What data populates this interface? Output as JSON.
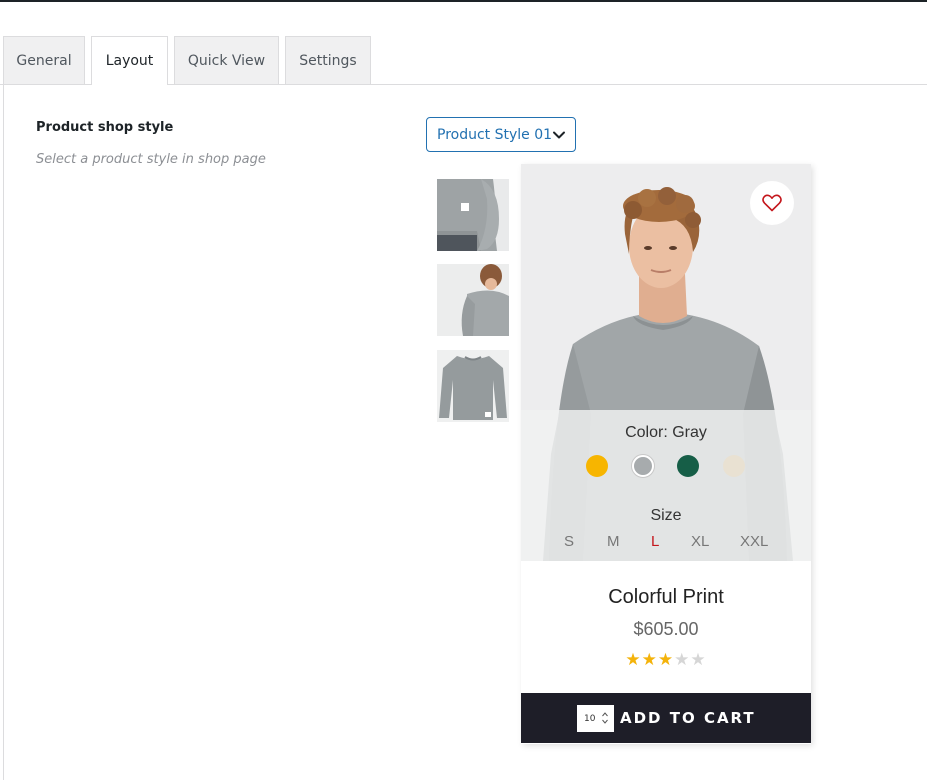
{
  "tabs": [
    {
      "label": "General"
    },
    {
      "label": "Layout"
    },
    {
      "label": "Quick View"
    },
    {
      "label": "Settings"
    }
  ],
  "setting": {
    "label": "Product shop style",
    "description": "Select a product style in shop page",
    "selected_value": "Product Style 01"
  },
  "product": {
    "color_label": "Color: Gray",
    "swatches": [
      "#f7b500",
      "#a7abad",
      "#165e47",
      "#e9e1d2"
    ],
    "size_label": "Size",
    "sizes": [
      "S",
      "M",
      "L",
      "XL",
      "XXL"
    ],
    "selected_size": "L",
    "title": "Colorful Print",
    "price": "$605.00",
    "rating": 3,
    "rating_max": 5,
    "quantity": "10",
    "add_to_cart": "ADD TO CART"
  },
  "colors": {
    "accent": "#2271b1",
    "selected_size": "#c4161c",
    "star": "#f4b30b",
    "cart_bar": "#1e1e28"
  },
  "icons": {
    "dropdown": "chevron-down-icon",
    "wishlist": "heart-icon",
    "quantity_spinner": "spinner-arrows-icon"
  }
}
